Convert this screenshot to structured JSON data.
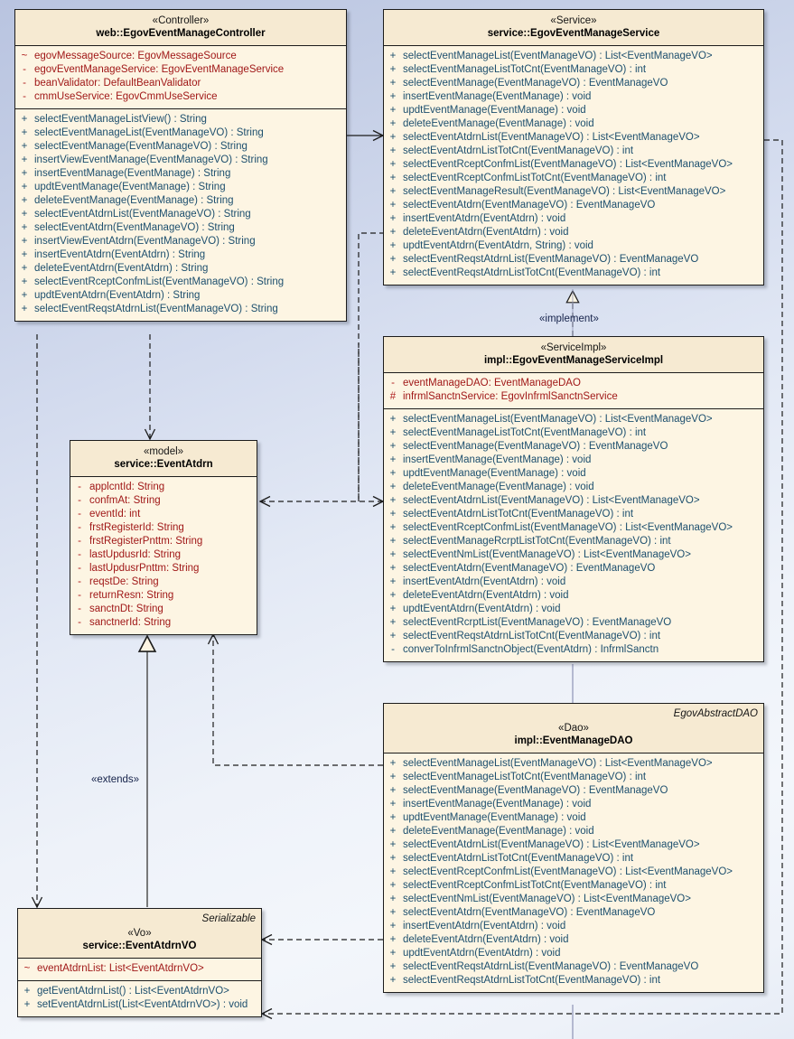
{
  "diagram": {
    "title": "EgovEventManage UML class diagram",
    "background_top": "#b9c4e0",
    "background_bottom": "#eef2f9",
    "class_fill": "#fdf5e3",
    "class_header_fill": "#f6ead2",
    "border_color": "#1c1c1c",
    "attribute_color": "#a01818",
    "method_color": "#1d4f6e"
  },
  "edge_labels": {
    "implement": "«implement»",
    "extends": "«extends»"
  },
  "classes": {
    "controller": {
      "stereotype": "«Controller»",
      "name": "web::EgovEventManageController",
      "attributes": [
        {
          "vis": "~",
          "sig": "egovMessageSource:  EgovMessageSource"
        },
        {
          "vis": "-",
          "sig": "egovEventManageService:  EgovEventManageService"
        },
        {
          "vis": "-",
          "sig": "beanValidator:  DefaultBeanValidator"
        },
        {
          "vis": "-",
          "sig": "cmmUseService:  EgovCmmUseService"
        }
      ],
      "methods": [
        {
          "vis": "+",
          "sig": "selectEventManageListView() : String"
        },
        {
          "vis": "+",
          "sig": "selectEventManageList(EventManageVO) : String"
        },
        {
          "vis": "+",
          "sig": "selectEventManage(EventManageVO) : String"
        },
        {
          "vis": "+",
          "sig": "insertViewEventManage(EventManageVO) : String"
        },
        {
          "vis": "+",
          "sig": "insertEventManage(EventManage) : String"
        },
        {
          "vis": "+",
          "sig": "updtEventManage(EventManage) : String"
        },
        {
          "vis": "+",
          "sig": "deleteEventManage(EventManage) : String"
        },
        {
          "vis": "+",
          "sig": "selectEventAtdrnList(EventManageVO) : String"
        },
        {
          "vis": "+",
          "sig": "selectEventAtdrn(EventManageVO) : String"
        },
        {
          "vis": "+",
          "sig": "insertViewEventAtdrn(EventManageVO) : String"
        },
        {
          "vis": "+",
          "sig": "insertEventAtdrn(EventAtdrn) : String"
        },
        {
          "vis": "+",
          "sig": "deleteEventAtdrn(EventAtdrn) : String"
        },
        {
          "vis": "+",
          "sig": "selectEventRceptConfmList(EventManageVO) : String"
        },
        {
          "vis": "+",
          "sig": "updtEventAtdrn(EventAtdrn) : String"
        },
        {
          "vis": "+",
          "sig": "selectEventReqstAtdrnList(EventManageVO) : String"
        }
      ]
    },
    "service": {
      "stereotype": "«Service»",
      "name": "service::EgovEventManageService",
      "methods": [
        {
          "vis": "+",
          "sig": "selectEventManageList(EventManageVO) : List<EventManageVO>"
        },
        {
          "vis": "+",
          "sig": "selectEventManageListTotCnt(EventManageVO) : int"
        },
        {
          "vis": "+",
          "sig": "selectEventManage(EventManageVO) : EventManageVO"
        },
        {
          "vis": "+",
          "sig": "insertEventManage(EventManage) : void"
        },
        {
          "vis": "+",
          "sig": "updtEventManage(EventManage) : void"
        },
        {
          "vis": "+",
          "sig": "deleteEventManage(EventManage) : void"
        },
        {
          "vis": "+",
          "sig": "selectEventAtdrnList(EventManageVO) : List<EventManageVO>"
        },
        {
          "vis": "+",
          "sig": "selectEventAtdrnListTotCnt(EventManageVO) : int"
        },
        {
          "vis": "+",
          "sig": "selectEventRceptConfmList(EventManageVO) : List<EventManageVO>"
        },
        {
          "vis": "+",
          "sig": "selectEventRceptConfmListTotCnt(EventManageVO) : int"
        },
        {
          "vis": "+",
          "sig": "selectEventManageResult(EventManageVO) : List<EventManageVO>"
        },
        {
          "vis": "+",
          "sig": "selectEventAtdrn(EventManageVO) : EventManageVO"
        },
        {
          "vis": "+",
          "sig": "insertEventAtdrn(EventAtdrn) : void"
        },
        {
          "vis": "+",
          "sig": "deleteEventAtdrn(EventAtdrn) : void"
        },
        {
          "vis": "+",
          "sig": "updtEventAtdrn(EventAtdrn, String) : void"
        },
        {
          "vis": "+",
          "sig": "selectEventReqstAtdrnList(EventManageVO) : EventManageVO"
        },
        {
          "vis": "+",
          "sig": "selectEventReqstAtdrnListTotCnt(EventManageVO) : int"
        }
      ]
    },
    "service_impl": {
      "stereotype": "«ServiceImpl»",
      "name": "impl::EgovEventManageServiceImpl",
      "attributes": [
        {
          "vis": "-",
          "sig": "eventManageDAO:  EventManageDAO"
        },
        {
          "vis": "#",
          "sig": "infrmlSanctnService:  EgovInfrmlSanctnService"
        }
      ],
      "methods": [
        {
          "vis": "+",
          "sig": "selectEventManageList(EventManageVO) : List<EventManageVO>"
        },
        {
          "vis": "+",
          "sig": "selectEventManageListTotCnt(EventManageVO) : int"
        },
        {
          "vis": "+",
          "sig": "selectEventManage(EventManageVO) : EventManageVO"
        },
        {
          "vis": "+",
          "sig": "insertEventManage(EventManage) : void"
        },
        {
          "vis": "+",
          "sig": "updtEventManage(EventManage) : void"
        },
        {
          "vis": "+",
          "sig": "deleteEventManage(EventManage) : void"
        },
        {
          "vis": "+",
          "sig": "selectEventAtdrnList(EventManageVO) : List<EventManageVO>"
        },
        {
          "vis": "+",
          "sig": "selectEventAtdrnListTotCnt(EventManageVO) : int"
        },
        {
          "vis": "+",
          "sig": "selectEventRceptConfmList(EventManageVO) : List<EventManageVO>"
        },
        {
          "vis": "+",
          "sig": "selectEventManageRcrptListTotCnt(EventManageVO) : int"
        },
        {
          "vis": "+",
          "sig": "selectEventNmList(EventManageVO) : List<EventManageVO>"
        },
        {
          "vis": "+",
          "sig": "selectEventAtdrn(EventManageVO) : EventManageVO"
        },
        {
          "vis": "+",
          "sig": "insertEventAtdrn(EventAtdrn) : void"
        },
        {
          "vis": "+",
          "sig": "deleteEventAtdrn(EventAtdrn) : void"
        },
        {
          "vis": "+",
          "sig": "updtEventAtdrn(EventAtdrn) : void"
        },
        {
          "vis": "+",
          "sig": "selectEventRcrptList(EventManageVO) : EventManageVO"
        },
        {
          "vis": "+",
          "sig": "selectEventReqstAtdrnListTotCnt(EventManageVO) : int"
        },
        {
          "vis": "-",
          "sig": "converToInfrmlSanctnObject(EventAtdrn) : InfrmlSanctn"
        }
      ]
    },
    "dao": {
      "super": "EgovAbstractDAO",
      "stereotype": "«Dao»",
      "name": "impl::EventManageDAO",
      "methods": [
        {
          "vis": "+",
          "sig": "selectEventManageList(EventManageVO) : List<EventManageVO>"
        },
        {
          "vis": "+",
          "sig": "selectEventManageListTotCnt(EventManageVO) : int"
        },
        {
          "vis": "+",
          "sig": "selectEventManage(EventManageVO) : EventManageVO"
        },
        {
          "vis": "+",
          "sig": "insertEventManage(EventManage) : void"
        },
        {
          "vis": "+",
          "sig": "updtEventManage(EventManage) : void"
        },
        {
          "vis": "+",
          "sig": "deleteEventManage(EventManage) : void"
        },
        {
          "vis": "+",
          "sig": "selectEventAtdrnList(EventManageVO) : List<EventManageVO>"
        },
        {
          "vis": "+",
          "sig": "selectEventAtdrnListTotCnt(EventManageVO) : int"
        },
        {
          "vis": "+",
          "sig": "selectEventRceptConfmList(EventManageVO) : List<EventManageVO>"
        },
        {
          "vis": "+",
          "sig": "selectEventRceptConfmListTotCnt(EventManageVO) : int"
        },
        {
          "vis": "+",
          "sig": "selectEventNmList(EventManageVO) : List<EventManageVO>"
        },
        {
          "vis": "+",
          "sig": "selectEventAtdrn(EventManageVO) : EventManageVO"
        },
        {
          "vis": "+",
          "sig": "insertEventAtdrn(EventAtdrn) : void"
        },
        {
          "vis": "+",
          "sig": "deleteEventAtdrn(EventAtdrn) : void"
        },
        {
          "vis": "+",
          "sig": "updtEventAtdrn(EventAtdrn) : void"
        },
        {
          "vis": "+",
          "sig": "selectEventReqstAtdrnList(EventManageVO) : EventManageVO"
        },
        {
          "vis": "+",
          "sig": "selectEventReqstAtdrnListTotCnt(EventManageVO) : int"
        }
      ]
    },
    "model": {
      "stereotype": "«model»",
      "name": "service::EventAtdrn",
      "attributes": [
        {
          "vis": "-",
          "sig": "applcntId:  String"
        },
        {
          "vis": "-",
          "sig": "confmAt:  String"
        },
        {
          "vis": "-",
          "sig": "eventId:  int"
        },
        {
          "vis": "-",
          "sig": "frstRegisterId:  String"
        },
        {
          "vis": "-",
          "sig": "frstRegisterPnttm:  String"
        },
        {
          "vis": "-",
          "sig": "lastUpdusrId:  String"
        },
        {
          "vis": "-",
          "sig": "lastUpdusrPnttm:  String"
        },
        {
          "vis": "-",
          "sig": "reqstDe:  String"
        },
        {
          "vis": "-",
          "sig": "returnResn:  String"
        },
        {
          "vis": "-",
          "sig": "sanctnDt:  String"
        },
        {
          "vis": "-",
          "sig": "sanctnerId:  String"
        }
      ]
    },
    "vo": {
      "super": "Serializable",
      "stereotype": "«Vo»",
      "name": "service::EventAtdrnVO",
      "attributes": [
        {
          "vis": "~",
          "sig": "eventAtdrnList:  List<EventAtdrnVO>"
        }
      ],
      "methods": [
        {
          "vis": "+",
          "sig": "getEventAtdrnList() : List<EventAtdrnVO>"
        },
        {
          "vis": "+",
          "sig": "setEventAtdrnList(List<EventAtdrnVO>) : void"
        }
      ]
    }
  }
}
